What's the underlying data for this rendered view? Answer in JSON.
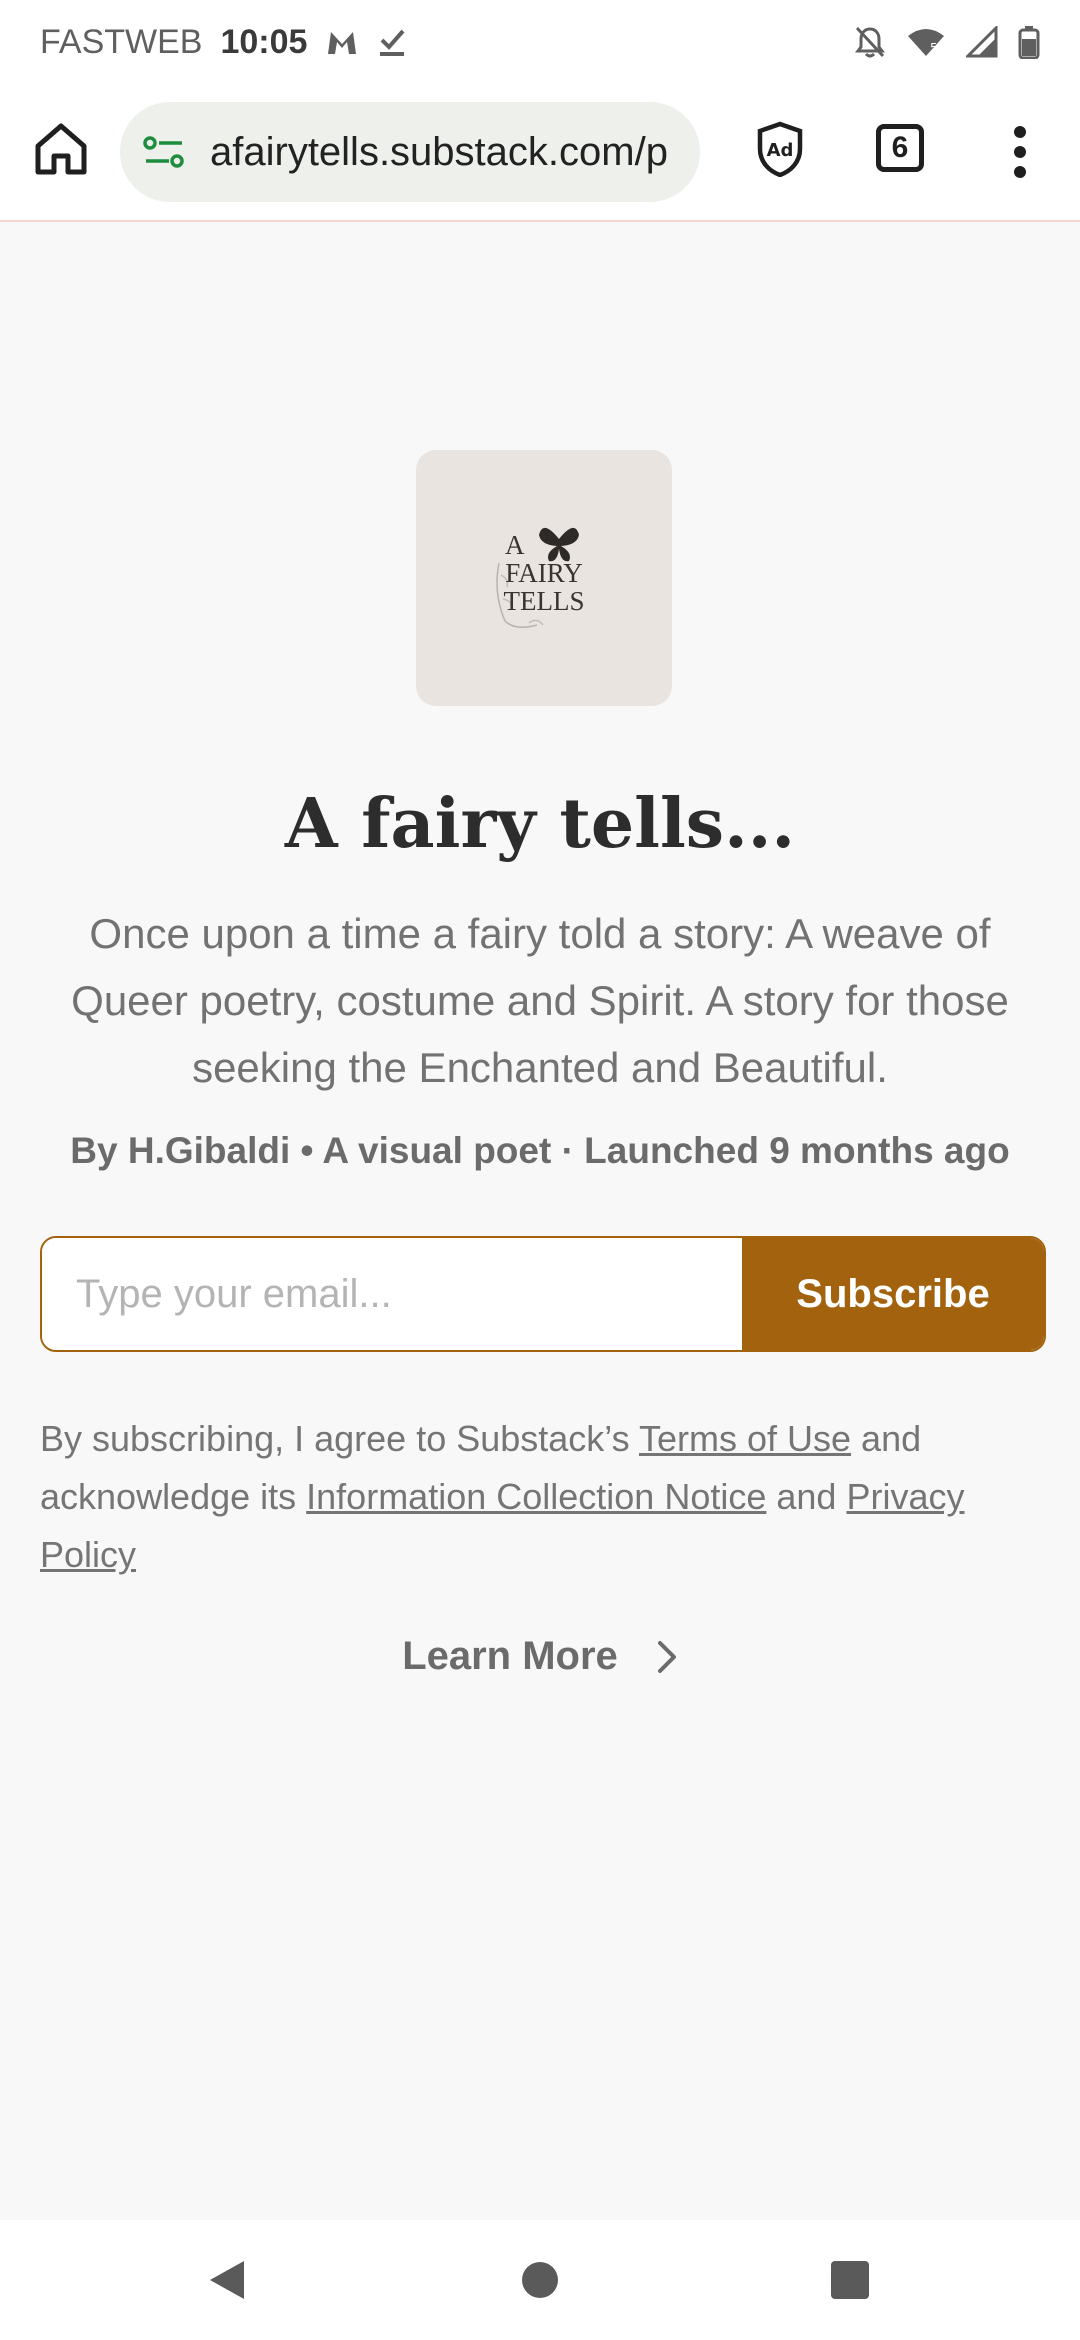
{
  "status_bar": {
    "carrier": "FASTWEB",
    "time": "10:05"
  },
  "browser": {
    "url": "afairytells.substack.com/p",
    "tab_count": "6"
  },
  "publication": {
    "logo_text": [
      "A",
      "FAIRY",
      "TELLS"
    ],
    "title": "A fairy tells...",
    "description": "Once upon a time a fairy told a story: A weave of Queer poetry, costume and Spirit. A story for those seeking the Enchanted and Beautiful.",
    "byline": "By H.Gibaldi • A visual poet · Launched 9 months ago"
  },
  "subscribe": {
    "placeholder": "Type your email...",
    "button_label": "Subscribe"
  },
  "legal": {
    "prefix": "By subscribing, I agree to Substack’s ",
    "terms_link": "Terms of Use",
    "middle": " and acknowledge its ",
    "notice_link": "Information Collection Notice",
    "and": " and ",
    "privacy_link": "Privacy Policy"
  },
  "learn_more": {
    "label": "Learn More"
  },
  "colors": {
    "accent": "#a3620e",
    "background": "#f8f8f8",
    "logo_background": "#e9e4df"
  }
}
